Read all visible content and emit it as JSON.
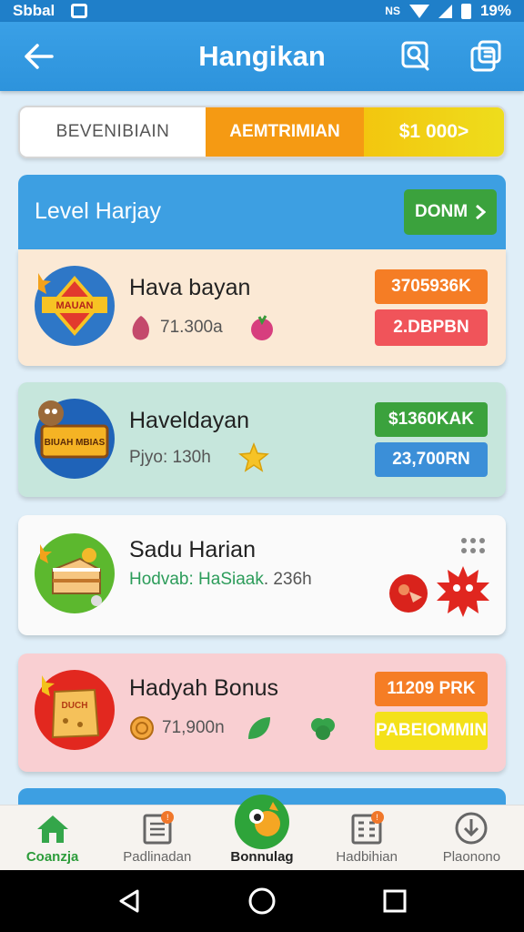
{
  "status": {
    "carrier": "Sbbal",
    "battery": "19%"
  },
  "app_bar": {
    "title": "Hangikan"
  },
  "segments": [
    "BEVENIBIAIN",
    "AEMTRIMIAN",
    "$1 000>"
  ],
  "level": {
    "title": "Level Harjay",
    "button_label": "DONM"
  },
  "cards": [
    {
      "title": "Hava bayan",
      "sub": "71.300a",
      "pill_top": "3705936K",
      "pill_bottom": "2.DBPBN",
      "icon_text": "MAUAN"
    },
    {
      "title": "Haveldayan",
      "sub": "Pjyo: 130h",
      "pill_top": "$1360KAK",
      "pill_bottom": "23,700RN",
      "icon_text": "BIUAH MBIAS"
    },
    {
      "title": "Sadu Harian",
      "sub_green": "Hodvab: HaSiaak",
      "sub_grey": ". 236h"
    },
    {
      "title": "Hadyah Bonus",
      "sub": "71,900n",
      "pill_top": "11209 PRK",
      "pill_bottom": "PABEIOMMIN",
      "icon_text": "DUCH"
    }
  ],
  "bottom_nav": [
    {
      "label": "Coanzja",
      "icon": "home-icon"
    },
    {
      "label": "Padlinadan",
      "icon": "document-icon",
      "badge": "!"
    },
    {
      "label": "Bonnulag",
      "icon": "bonus-icon"
    },
    {
      "label": "Hadbihian",
      "icon": "grid-icon",
      "badge": "!"
    },
    {
      "label": "Plaonono",
      "icon": "download-icon"
    }
  ],
  "colors": {
    "primary": "#3d9fe2",
    "accent_orange": "#f59a13",
    "accent_green": "#3ba23d",
    "accent_red": "#f0545a"
  }
}
